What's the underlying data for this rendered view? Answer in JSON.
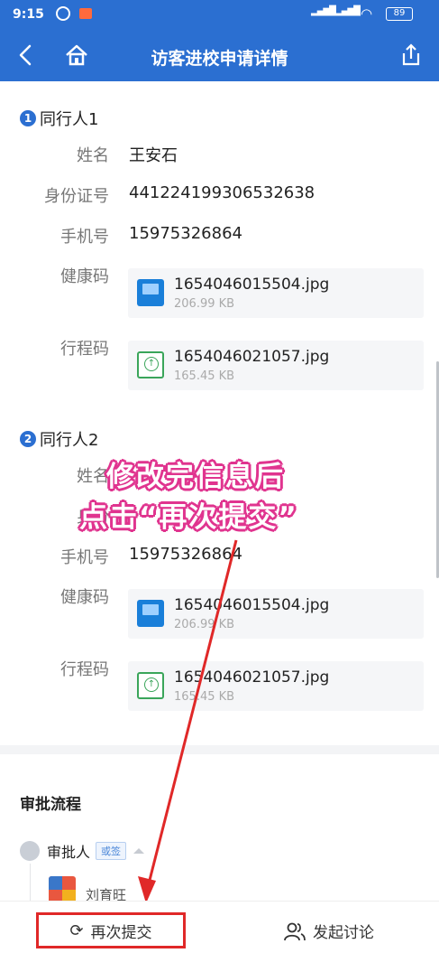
{
  "statusbar": {
    "time": "9:15",
    "battery": "89"
  },
  "header": {
    "title": "访客进校申请详情",
    "back_icon": "back-arrow",
    "home_icon": "home",
    "share_icon": "share"
  },
  "companions": [
    {
      "index": "1",
      "title": "同行人1",
      "name_label": "姓名",
      "name": "王安石",
      "id_label": "身份证号",
      "id": "441224199306532638",
      "phone_label": "手机号",
      "phone": "15975326864",
      "health_label": "健康码",
      "health_file": "1654046015504.jpg",
      "health_size": "206.99 KB",
      "trip_label": "行程码",
      "trip_file": "1654046021057.jpg",
      "trip_size": "165.45 KB"
    },
    {
      "index": "2",
      "title": "同行人2",
      "name_label": "姓名",
      "name": "",
      "id_label": "身份",
      "id": "",
      "phone_label": "手机号",
      "phone": "15975326864",
      "health_label": "健康码",
      "health_file": "1654046015504.jpg",
      "health_size": "206.99 KB",
      "trip_label": "行程码",
      "trip_file": "1654046021057.jpg",
      "trip_size": "165.45 KB"
    }
  ],
  "approval": {
    "title": "审批流程",
    "role": "审批人",
    "tag": "或签",
    "person": "刘育旺"
  },
  "overlay": {
    "line1": "修改完信息后",
    "line2": "点击“再次提交”",
    "color": "#e0348f"
  },
  "bottom": {
    "resubmit": "再次提交",
    "discuss": "发起讨论",
    "highlight_color": "#e02828"
  }
}
